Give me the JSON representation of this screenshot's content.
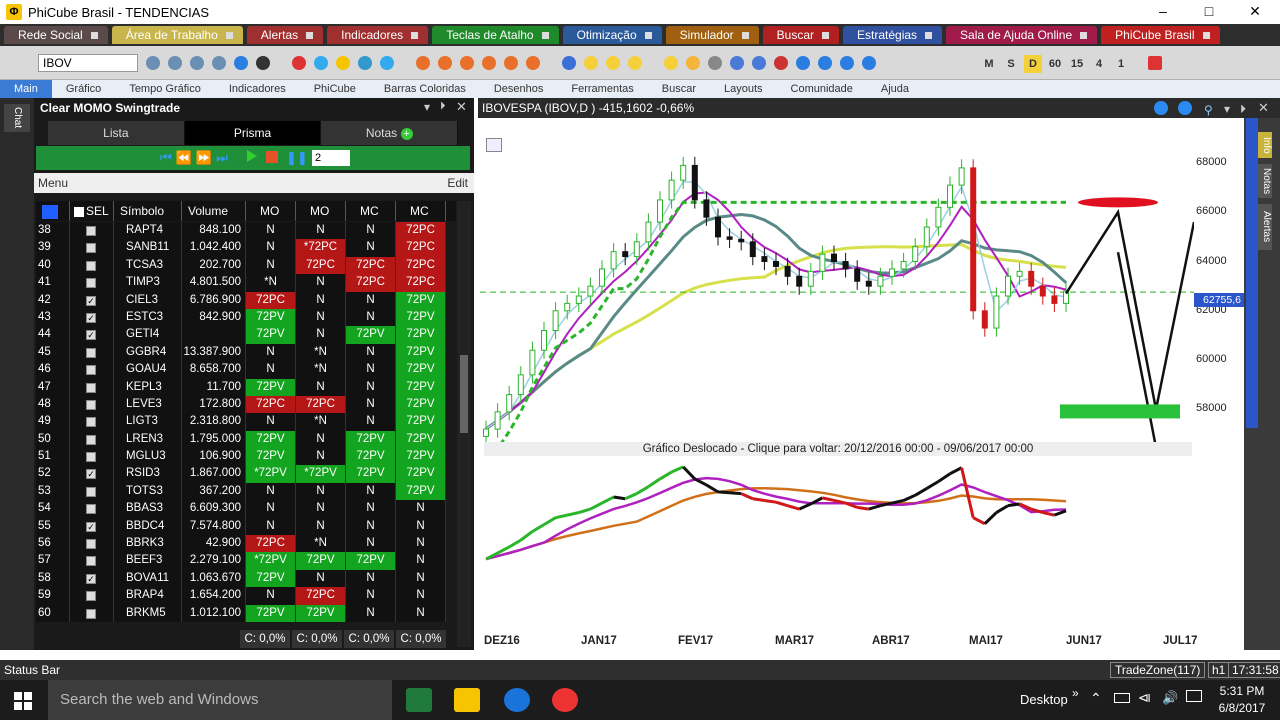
{
  "window": {
    "title": "PhiCube Brasil - TENDENCIAS",
    "logo": "PhiCube"
  },
  "menu_tabs": [
    {
      "label": "Rede Social",
      "color": "#5a4a4a"
    },
    {
      "label": "Área de Trabalho",
      "color": "#c8b64c"
    },
    {
      "label": "Alertas",
      "color": "#a03030"
    },
    {
      "label": "Indicadores",
      "color": "#a03030"
    },
    {
      "label": "Teclas de Atalho",
      "color": "#1e8a2a"
    },
    {
      "label": "Otimização",
      "color": "#2a5a9a"
    },
    {
      "label": "Simulador",
      "color": "#a06010"
    },
    {
      "label": "Buscar",
      "color": "#b02020"
    },
    {
      "label": "Estratégias",
      "color": "#3050a0"
    },
    {
      "label": "Sala de Ajuda Online",
      "color": "#a01a4a"
    },
    {
      "label": "PhiCube Brasil",
      "color": "#c02020"
    }
  ],
  "toolbar": {
    "symbol": "IBOV",
    "periods": [
      "M",
      "S",
      "D",
      "60",
      "15",
      "4",
      "1"
    ]
  },
  "ribbon_tabs": [
    "Main",
    "Gráfico",
    "Tempo Gráfico",
    "Indicadores",
    "PhiCube",
    "Barras Coloridas",
    "Desenhos",
    "Ferramentas",
    "Buscar",
    "Layouts",
    "Comunidade",
    "Ajuda"
  ],
  "chat_label": "Chat",
  "left_panel": {
    "title": "Clear MOMO Swingtrade",
    "tabs": [
      "Lista",
      "Prisma",
      "Notas"
    ],
    "spinner_value": "2",
    "menu_label": "Menu",
    "edit_label": "Edit",
    "columns": [
      "SEL",
      "Símbolo",
      "Volume",
      "MO",
      "MO",
      "MC",
      "MC"
    ],
    "rows": [
      {
        "n": "38",
        "chk": false,
        "sym": "RAPT4",
        "vol": "848.100",
        "s": [
          "N",
          "N",
          "N",
          "72PC"
        ]
      },
      {
        "n": "39",
        "chk": false,
        "sym": "SANB11",
        "vol": "1.042.400",
        "s": [
          "N",
          "*72PC",
          "N",
          "72PC"
        ]
      },
      {
        "n": "40",
        "chk": false,
        "sym": "TCSA3",
        "vol": "202.700",
        "s": [
          "N",
          "72PC",
          "72PC",
          "72PC"
        ]
      },
      {
        "n": "41",
        "chk": false,
        "sym": "TIMP3",
        "vol": "4.801.500",
        "s": [
          "*N",
          "N",
          "72PC",
          "72PC"
        ]
      },
      {
        "n": "42",
        "chk": true,
        "sym": "CIEL3",
        "vol": "6.786.900",
        "s": [
          "72PC",
          "N",
          "N",
          "72PV"
        ]
      },
      {
        "n": "43",
        "chk": true,
        "sym": "ESTC3",
        "vol": "842.900",
        "s": [
          "72PV",
          "N",
          "N",
          "72PV"
        ]
      },
      {
        "n": "44",
        "chk": true,
        "sym": "GETI4",
        "vol": "",
        "s": [
          "72PV",
          "N",
          "72PV",
          "72PV"
        ]
      },
      {
        "n": "45",
        "chk": false,
        "sym": "GGBR4",
        "vol": "13.387.900",
        "s": [
          "N",
          "*N",
          "N",
          "72PV"
        ]
      },
      {
        "n": "46",
        "chk": false,
        "sym": "GOAU4",
        "vol": "8.658.700",
        "s": [
          "N",
          "*N",
          "N",
          "72PV"
        ]
      },
      {
        "n": "47",
        "chk": false,
        "sym": "KEPL3",
        "vol": "11.700",
        "s": [
          "72PV",
          "N",
          "N",
          "72PV"
        ]
      },
      {
        "n": "48",
        "chk": false,
        "sym": "LEVE3",
        "vol": "172.800",
        "s": [
          "72PC",
          "72PC",
          "N",
          "72PV"
        ]
      },
      {
        "n": "49",
        "chk": false,
        "sym": "LIGT3",
        "vol": "2.318.800",
        "s": [
          "N",
          "*N",
          "N",
          "72PV"
        ]
      },
      {
        "n": "50",
        "chk": false,
        "sym": "LREN3",
        "vol": "1.795.000",
        "s": [
          "72PV",
          "N",
          "72PV",
          "72PV"
        ]
      },
      {
        "n": "51",
        "chk": false,
        "sym": "MGLU3",
        "vol": "106.900",
        "s": [
          "72PV",
          "N",
          "72PV",
          "72PV"
        ]
      },
      {
        "n": "52",
        "chk": true,
        "sym": "RSID3",
        "vol": "1.867.000",
        "s": [
          "*72PV",
          "*72PV",
          "72PV",
          "72PV"
        ]
      },
      {
        "n": "53",
        "chk": false,
        "sym": "TOTS3",
        "vol": "367.200",
        "s": [
          "N",
          "N",
          "N",
          "72PV"
        ]
      },
      {
        "n": "54",
        "chk": false,
        "sym": "BBAS3",
        "vol": "6.609.300",
        "s": [
          "N",
          "N",
          "N",
          "N"
        ]
      },
      {
        "n": "55",
        "chk": true,
        "sym": "BBDC4",
        "vol": "7.574.800",
        "s": [
          "N",
          "N",
          "N",
          "N"
        ]
      },
      {
        "n": "56",
        "chk": false,
        "sym": "BBRK3",
        "vol": "42.900",
        "s": [
          "72PC",
          "*N",
          "N",
          "N"
        ]
      },
      {
        "n": "57",
        "chk": false,
        "sym": "BEEF3",
        "vol": "2.279.100",
        "s": [
          "*72PV",
          "72PV",
          "72PV",
          "N"
        ]
      },
      {
        "n": "58",
        "chk": true,
        "sym": "BOVA11",
        "vol": "1.063.670",
        "s": [
          "72PV",
          "N",
          "N",
          "N"
        ]
      },
      {
        "n": "59",
        "chk": false,
        "sym": "BRAP4",
        "vol": "1.654.200",
        "s": [
          "N",
          "72PC",
          "N",
          "N"
        ]
      },
      {
        "n": "60",
        "chk": false,
        "sym": "BRKM5",
        "vol": "1.012.100",
        "s": [
          "72PV",
          "72PV",
          "N",
          "N"
        ]
      }
    ],
    "footer": [
      "C: 0,0%",
      "C: 0,0%",
      "C: 0,0%",
      "C: 0,0%"
    ]
  },
  "chart": {
    "title": "IBOVESPA (IBOV,D ) -415,1602 -0,66%",
    "last_price": "62755,6",
    "shift_note": "Gráfico Deslocado - Clique para voltar: 20/12/2016 00:00 - 09/06/2017 00:00",
    "side_tabs": [
      "Info",
      "Notas",
      "Alertas"
    ]
  },
  "chart_data": {
    "type": "line",
    "x_labels": [
      "DEZ16",
      "JAN17",
      "FEV17",
      "MAR17",
      "ABR17",
      "MAI17",
      "JUN17",
      "JUL17"
    ],
    "y_ticks": [
      68000,
      66000,
      64000,
      62000,
      60000,
      58000
    ],
    "ylim": [
      57000,
      69500
    ],
    "last_value": 62755.6,
    "close": [
      57200,
      57900,
      58600,
      59400,
      60400,
      61200,
      62000,
      62300,
      62600,
      63000,
      63700,
      64400,
      64200,
      64800,
      65600,
      66500,
      67300,
      67900,
      66500,
      65800,
      65000,
      64900,
      64800,
      64200,
      64000,
      63800,
      63400,
      63000,
      63600,
      64300,
      64000,
      63700,
      63200,
      63000,
      63400,
      63700,
      64000,
      64600,
      65400,
      66200,
      67100,
      67800,
      62000,
      61300,
      62600,
      63400,
      63600,
      63000,
      62600,
      62300,
      62800
    ]
  },
  "status_bar": {
    "label": "Status Bar",
    "tradezone": "TradeZone(117)",
    "h1": "h1",
    "clock": "17:31:58"
  },
  "taskbar": {
    "search_placeholder": "Search the web and Windows",
    "desktop": "Desktop",
    "time": "5:31 PM",
    "date": "6/8/2017"
  }
}
